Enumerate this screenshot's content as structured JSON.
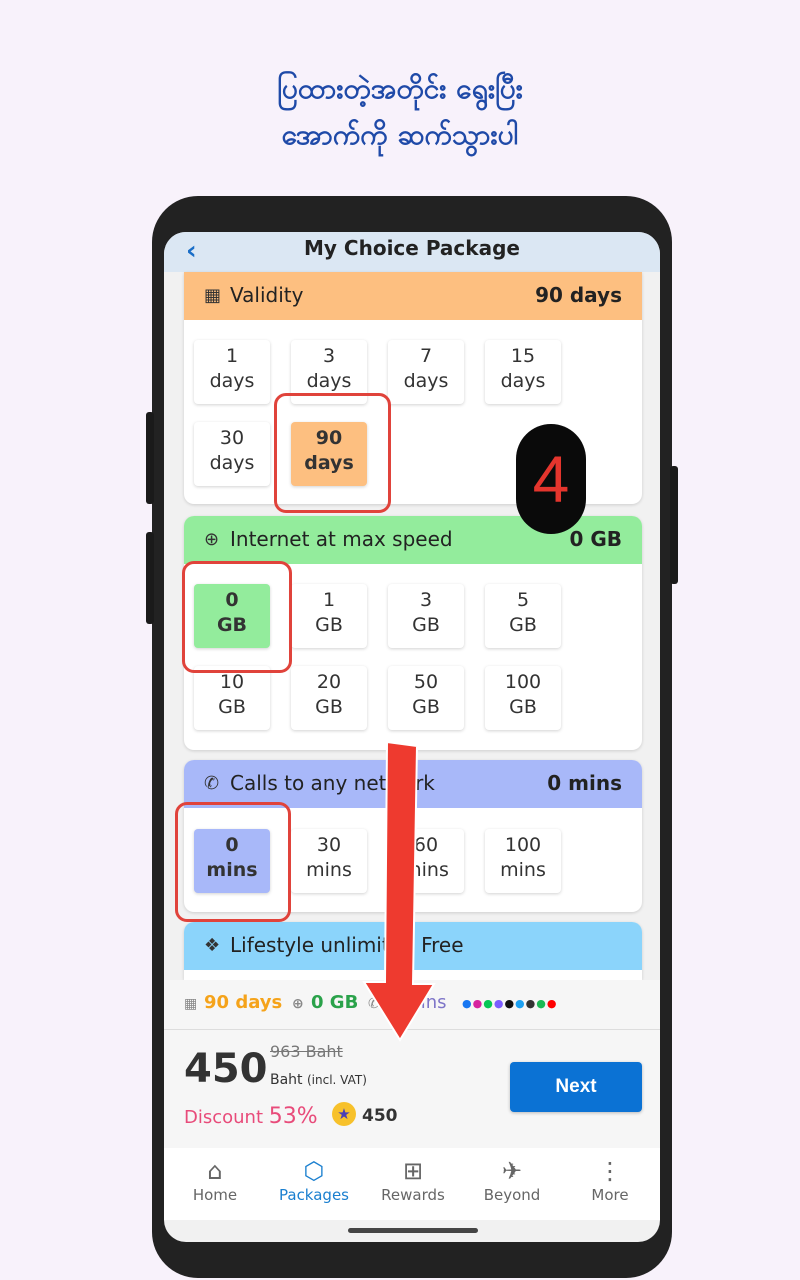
{
  "instruction": {
    "line1": "ပြထားတဲ့အတိုင်း ရွေးပြီး",
    "line2": "အောက်ကို ဆက်သွားပါ"
  },
  "header": {
    "back_icon": "chevron-left-icon",
    "title": "My Choice Package"
  },
  "validity": {
    "title": "Validity",
    "value": "90 days",
    "color": "#fdbf80",
    "options": [
      {
        "num": "1",
        "unit": "days"
      },
      {
        "num": "3",
        "unit": "days"
      },
      {
        "num": "7",
        "unit": "days"
      },
      {
        "num": "15",
        "unit": "days"
      },
      {
        "num": "30",
        "unit": "days"
      },
      {
        "num": "90",
        "unit": "days",
        "selected": true
      }
    ]
  },
  "internet": {
    "title": "Internet at max speed",
    "value": "0 GB",
    "color": "#93ec9c",
    "options": [
      {
        "num": "0",
        "unit": "GB",
        "selected": true
      },
      {
        "num": "1",
        "unit": "GB"
      },
      {
        "num": "3",
        "unit": "GB"
      },
      {
        "num": "5",
        "unit": "GB"
      },
      {
        "num": "10",
        "unit": "GB"
      },
      {
        "num": "20",
        "unit": "GB"
      },
      {
        "num": "50",
        "unit": "GB"
      },
      {
        "num": "100",
        "unit": "GB"
      }
    ]
  },
  "calls": {
    "title": "Calls to any network",
    "value": "0 mins",
    "color": "#a8b8f9",
    "options": [
      {
        "num": "0",
        "unit": "mins",
        "selected": true
      },
      {
        "num": "30",
        "unit": "mins"
      },
      {
        "num": "60",
        "unit": "mins"
      },
      {
        "num": "100",
        "unit": "mins"
      }
    ]
  },
  "lifestyle": {
    "title": "Lifestyle unlimited Free",
    "color": "#8bd4fb"
  },
  "summary": {
    "validity": "90 days",
    "internet": "0 GB",
    "calls": "0 mins",
    "validity_color": "#f5a31a",
    "internet_color": "#2aa24a",
    "calls_color": "#7e75c8"
  },
  "price": {
    "amount": "450",
    "original": "963 Baht",
    "currency": "Baht",
    "vat": "(incl. VAT)",
    "discount_label": "Discount",
    "discount_value": "53%",
    "points": "450"
  },
  "next_label": "Next",
  "nav": [
    {
      "label": "Home",
      "icon": "home-icon"
    },
    {
      "label": "Packages",
      "icon": "box-icon",
      "active": true
    },
    {
      "label": "Rewards",
      "icon": "gift-icon"
    },
    {
      "label": "Beyond",
      "icon": "plane-icon"
    },
    {
      "label": "More",
      "icon": "more-vertical-icon"
    }
  ],
  "step_badge": "4"
}
